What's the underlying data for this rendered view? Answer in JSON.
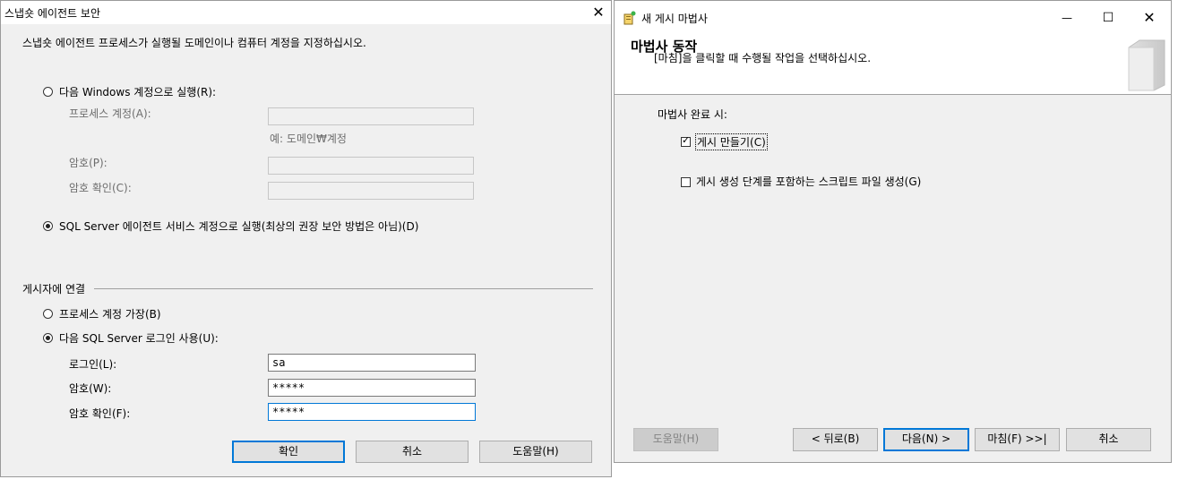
{
  "left": {
    "title": "스냅숏 에이전트 보안",
    "description": "스냅숏 에이전트 프로세스가 실행될 도메인이나 컴퓨터 계정을 지정하십시오.",
    "option_windows": "다음 Windows 계정으로 실행(R):",
    "process_account_label": "프로세스 계정(A):",
    "process_account_hint": "예: 도메인₩계정",
    "password_label": "암호(P):",
    "password_confirm_label": "암호 확인(C):",
    "option_sql_agent": "SQL Server 에이전트 서비스 계정으로 실행(최상의 권장 보안 방법은 아님)(D)",
    "publisher_section": "게시자에 연결",
    "option_impersonate": "프로세스 계정 가장(B)",
    "option_sql_login": "다음 SQL Server 로그인 사용(U):",
    "login_label": "로그인(L):",
    "login_value": "sa",
    "pw_label": "암호(W):",
    "pw_value": "*****",
    "pw_confirm_label": "암호 확인(F):",
    "pw_confirm_value": "*****",
    "ok": "확인",
    "cancel": "취소",
    "help": "도움말(H)",
    "close_glyph": "✕"
  },
  "right": {
    "title": "새 게시 마법사",
    "header_title": "마법사 동작",
    "header_sub": "[마침]을 클릭할 때 수행될 작업을 선택하십시오.",
    "group_label": "마법사 완료 시:",
    "cb_create": "게시 만들기(C)",
    "cb_script": "게시 생성 단계를 포함하는 스크립트 파일 생성(G)",
    "help": "도움말(H)",
    "back": "< 뒤로(B)",
    "next": "다음(N) >",
    "finish": "마침(F) >>|",
    "cancel": "취소",
    "minimize_glyph": "—",
    "maximize_glyph": "☐",
    "close_glyph": "✕"
  },
  "colors": {
    "accent": "#0078d7",
    "dialog_bg": "#f0f0f0"
  }
}
